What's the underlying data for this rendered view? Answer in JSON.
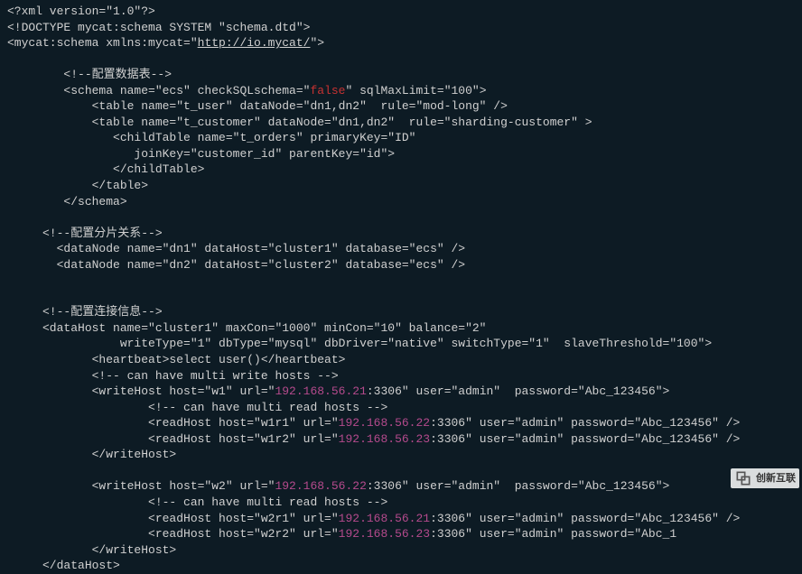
{
  "line0": "<?xml version=\"1.0\"?>",
  "line1": "<!DOCTYPE mycat:schema SYSTEM \"schema.dtd\">",
  "line2a": "<mycat:schema xmlns:mycat=\"",
  "line2url": "http://io.mycat/",
  "line2b": "\">",
  "blank1": " ",
  "line3": "        <!--配置数据表-->",
  "line4a": "        <schema name=\"ecs\" checkSQLschema=\"",
  "line4false": "false",
  "line4b": "\" sqlMaxLimit=\"100\">",
  "line5": "            <table name=\"t_user\" dataNode=\"dn1,dn2\"  rule=\"mod-long\" />",
  "line6": "            <table name=\"t_customer\" dataNode=\"dn1,dn2\"  rule=\"sharding-customer\" >",
  "line7": "               <childTable name=\"t_orders\" primaryKey=\"ID\"",
  "line8": "                  joinKey=\"customer_id\" parentKey=\"id\">",
  "line9": "               </childTable>",
  "line10": "            </table>",
  "line11": "        </schema>",
  "blank2": " ",
  "line12": "     <!--配置分片关系-->",
  "line13": "       <dataNode name=\"dn1\" dataHost=\"cluster1\" database=\"ecs\" />",
  "line14": "       <dataNode name=\"dn2\" dataHost=\"cluster2\" database=\"ecs\" />",
  "blank3": " ",
  "blank4": " ",
  "line15": "     <!--配置连接信息-->",
  "line16": "     <dataHost name=\"cluster1\" maxCon=\"1000\" minCon=\"10\" balance=\"2\"",
  "line17": "                writeType=\"1\" dbType=\"mysql\" dbDriver=\"native\" switchType=\"1\"  slaveThreshold=\"100\">",
  "line18": "            <heartbeat>select user()</heartbeat>",
  "line19": "            <!-- can have multi write hosts -->",
  "line20a": "            <writeHost host=\"w1\" url=\"",
  "line20ip": "192.168.56.21",
  "line20b": ":3306\" user=\"admin\"  password=\"Abc_123456\">",
  "line21": "                    <!-- can have multi read hosts -->",
  "line22a": "                    <readHost host=\"w1r1\" url=\"",
  "line22ip": "192.168.56.22",
  "line22b": ":3306\" user=\"admin\" password=\"Abc_123456\" />",
  "line23a": "                    <readHost host=\"w1r2\" url=\"",
  "line23ip": "192.168.56.23",
  "line23b": ":3306\" user=\"admin\" password=\"Abc_123456\" />",
  "line24": "            </writeHost>",
  "blank5": " ",
  "line25a": "            <writeHost host=\"w2\" url=\"",
  "line25ip": "192.168.56.22",
  "line25b": ":3306\" user=\"admin\"  password=\"Abc_123456\">",
  "line26": "                    <!-- can have multi read hosts -->",
  "line27a": "                    <readHost host=\"w2r1\" url=\"",
  "line27ip": "192.168.56.21",
  "line27b": ":3306\" user=\"admin\" password=\"Abc_123456\" />",
  "line28a": "                    <readHost host=\"w2r2\" url=\"",
  "line28ip": "192.168.56.23",
  "line28b": ":3306\" user=\"admin\" password=\"Abc_1",
  "line29": "            </writeHost>",
  "line30": "     </dataHost>",
  "watermark": "创新互联"
}
